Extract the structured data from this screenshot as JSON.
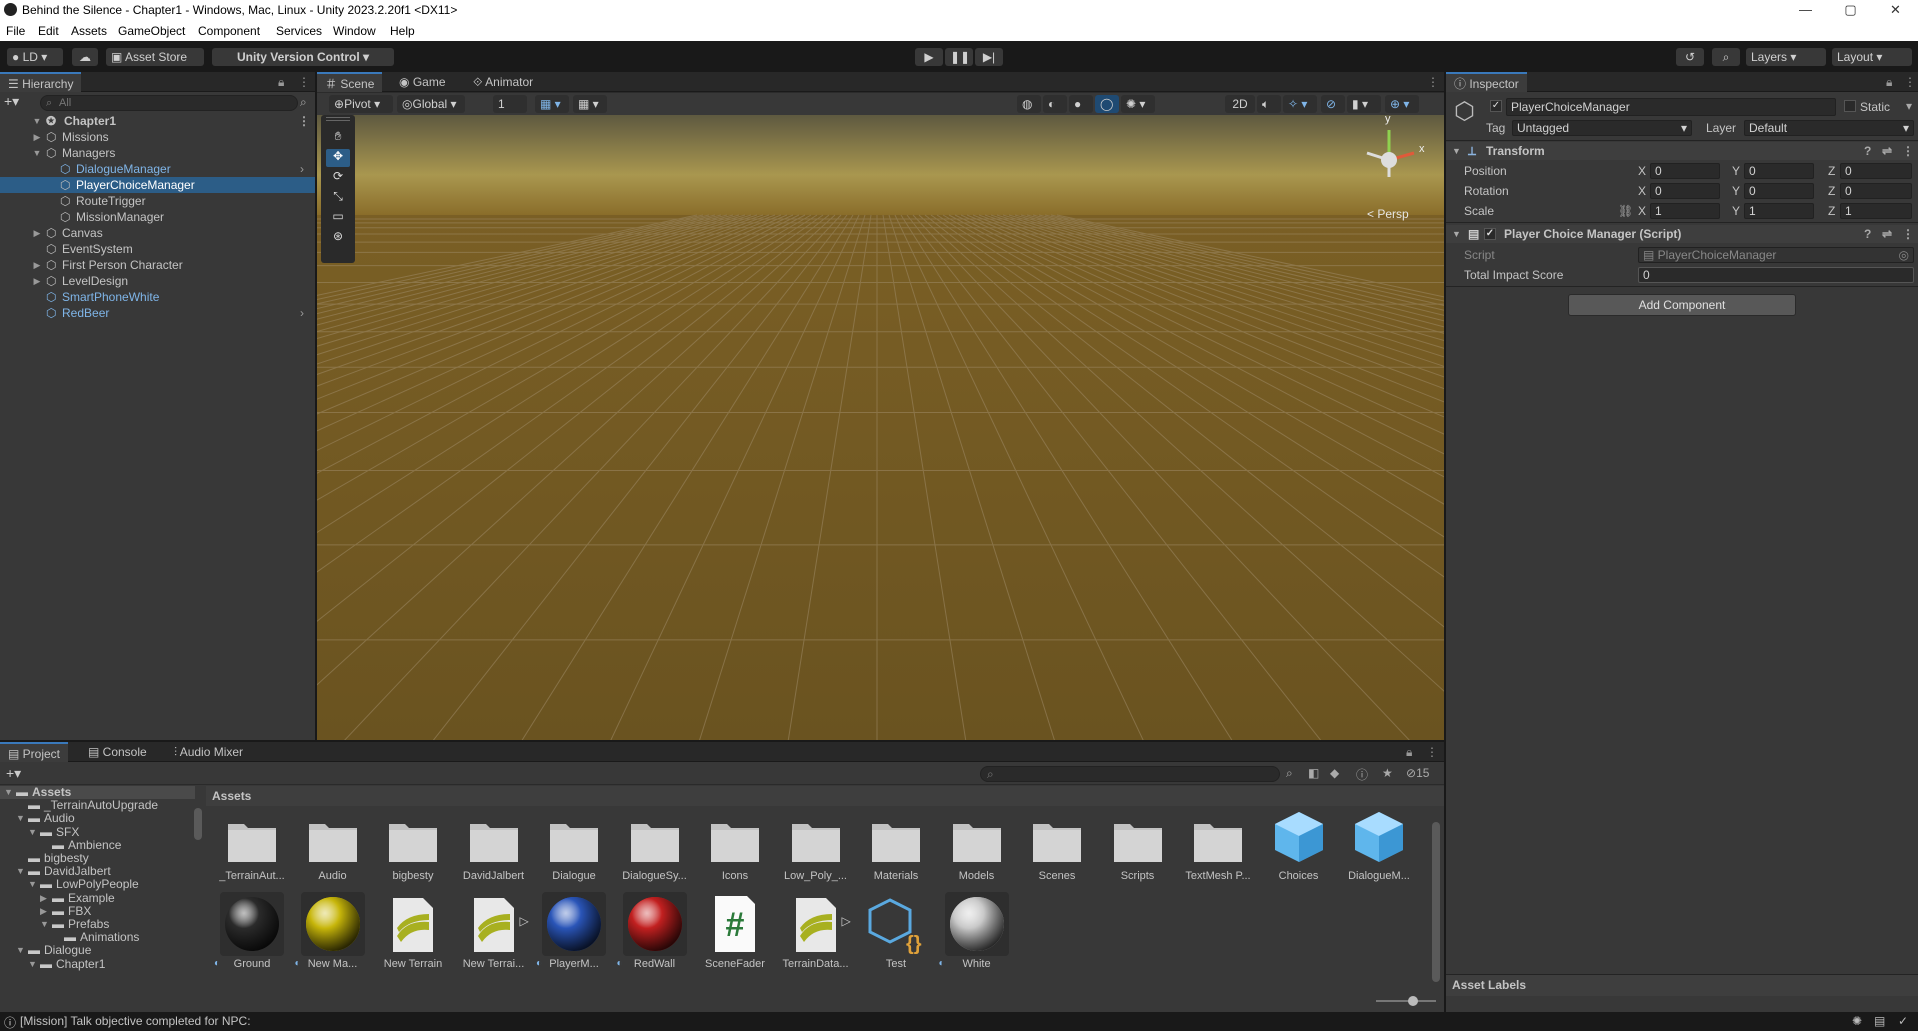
{
  "window": {
    "title": "Behind the Silence - Chapter1 - Windows, Mac, Linux - Unity 2023.2.20f1 <DX11>",
    "minimize": "—",
    "maximize": "▢",
    "close": "✕"
  },
  "menu": [
    "File",
    "Edit",
    "Assets",
    "GameObject",
    "Component",
    "Services",
    "Window",
    "Help"
  ],
  "toolbar": {
    "account": "LD",
    "asset_store": "Asset Store",
    "version_control": "Unity Version Control",
    "layers": "Layers",
    "layout": "Layout"
  },
  "hierarchy": {
    "tab": "Hierarchy",
    "search_placeholder": "All",
    "scene": "Chapter1",
    "items": [
      {
        "label": "Missions",
        "depth": 1,
        "arrow": "▶",
        "prefab": false,
        "selected": false
      },
      {
        "label": "Managers",
        "depth": 1,
        "arrow": "▼",
        "prefab": false,
        "selected": false
      },
      {
        "label": "DialogueManager",
        "depth": 2,
        "arrow": "",
        "prefab": true,
        "selected": false
      },
      {
        "label": "PlayerChoiceManager",
        "depth": 2,
        "arrow": "",
        "prefab": false,
        "selected": true
      },
      {
        "label": "RouteTrigger",
        "depth": 2,
        "arrow": "",
        "prefab": false,
        "selected": false
      },
      {
        "label": "MissionManager",
        "depth": 2,
        "arrow": "",
        "prefab": false,
        "selected": false
      },
      {
        "label": "Canvas",
        "depth": 1,
        "arrow": "▶",
        "prefab": false,
        "selected": false
      },
      {
        "label": "EventSystem",
        "depth": 1,
        "arrow": "",
        "prefab": false,
        "selected": false
      },
      {
        "label": "First Person Character",
        "depth": 1,
        "arrow": "▶",
        "prefab": false,
        "selected": false
      },
      {
        "label": "LevelDesign",
        "depth": 1,
        "arrow": "▶",
        "prefab": false,
        "selected": false
      },
      {
        "label": "SmartPhoneWhite",
        "depth": 1,
        "arrow": "",
        "prefab": true,
        "selected": false
      },
      {
        "label": "RedBeer",
        "depth": 1,
        "arrow": "",
        "prefab": true,
        "selected": false
      }
    ]
  },
  "scene": {
    "tabs": [
      "Scene",
      "Game",
      "Animator"
    ],
    "pivot": "Pivot",
    "global": "Global",
    "grid_value": "1",
    "mode_2d": "2D",
    "persp": "< Persp",
    "gizmo_y": "y",
    "gizmo_x": "x"
  },
  "inspector": {
    "tab": "Inspector",
    "object_name": "PlayerChoiceManager",
    "static_label": "Static",
    "tag_label": "Tag",
    "tag_value": "Untagged",
    "layer_label": "Layer",
    "layer_value": "Default",
    "transform": {
      "title": "Transform",
      "position": {
        "label": "Position",
        "x": "0",
        "y": "0",
        "z": "0"
      },
      "rotation": {
        "label": "Rotation",
        "x": "0",
        "y": "0",
        "z": "0"
      },
      "scale": {
        "label": "Scale",
        "x": "1",
        "y": "1",
        "z": "1"
      }
    },
    "script_component": {
      "title": "Player Choice Manager (Script)",
      "script_label": "Script",
      "script_value": "PlayerChoiceManager",
      "impact_label": "Total Impact Score",
      "impact_value": "0"
    },
    "add_component": "Add Component",
    "asset_labels": "Asset Labels"
  },
  "project": {
    "tabs": [
      "Project",
      "Console",
      "Audio Mixer"
    ],
    "hidden_count": "15",
    "breadcrumb": "Assets",
    "tree": [
      {
        "label": "Assets",
        "depth": 0,
        "arrow": "▼",
        "bold": true
      },
      {
        "label": "_TerrainAutoUpgrade",
        "depth": 1,
        "arrow": ""
      },
      {
        "label": "Audio",
        "depth": 1,
        "arrow": "▼"
      },
      {
        "label": "SFX",
        "depth": 2,
        "arrow": "▼"
      },
      {
        "label": "Ambience",
        "depth": 3,
        "arrow": ""
      },
      {
        "label": "bigbesty",
        "depth": 1,
        "arrow": ""
      },
      {
        "label": "DavidJalbert",
        "depth": 1,
        "arrow": "▼"
      },
      {
        "label": "LowPolyPeople",
        "depth": 2,
        "arrow": "▼"
      },
      {
        "label": "Example",
        "depth": 3,
        "arrow": "▶"
      },
      {
        "label": "FBX",
        "depth": 3,
        "arrow": "▶"
      },
      {
        "label": "Prefabs",
        "depth": 3,
        "arrow": "▼"
      },
      {
        "label": "Animations",
        "depth": 4,
        "arrow": ""
      },
      {
        "label": "Dialogue",
        "depth": 1,
        "arrow": "▼"
      },
      {
        "label": "Chapter1",
        "depth": 2,
        "arrow": "▼"
      }
    ],
    "folders": [
      "_TerrainAut...",
      "Audio",
      "bigbesty",
      "DavidJalbert",
      "Dialogue",
      "DialogueSy...",
      "Icons",
      "Low_Poly_...",
      "Materials",
      "Models",
      "Scenes",
      "Scripts",
      "TextMesh P...",
      "Choices",
      "DialogueM..."
    ],
    "assets": [
      {
        "label": "Ground",
        "kind": "sphere",
        "color": "#2b2b2b"
      },
      {
        "label": "New Ma...",
        "kind": "sphere",
        "color": "#c7b60a"
      },
      {
        "label": "New Terrain",
        "kind": "terrain",
        "color": "#a8b020"
      },
      {
        "label": "New Terrai...",
        "kind": "terrain",
        "color": "#a8b020"
      },
      {
        "label": "PlayerM...",
        "kind": "sphere",
        "color": "#2a55b8"
      },
      {
        "label": "RedWall",
        "kind": "sphere",
        "color": "#c22020"
      },
      {
        "label": "SceneFader",
        "kind": "script",
        "color": "#2b7a3a"
      },
      {
        "label": "TerrainData...",
        "kind": "terrain",
        "color": "#a8b020"
      },
      {
        "label": "Test",
        "kind": "scriptcube",
        "color": "#5aa9e0"
      },
      {
        "label": "White",
        "kind": "sphere",
        "color": "#c8c8c8"
      }
    ]
  },
  "status": {
    "message": "[Mission] Talk objective completed for NPC:"
  },
  "colors": {
    "accent": "#2c5d87",
    "prefab": "#7fb5e8",
    "sky_top": "#5e5940",
    "ground": "#6a5320"
  }
}
